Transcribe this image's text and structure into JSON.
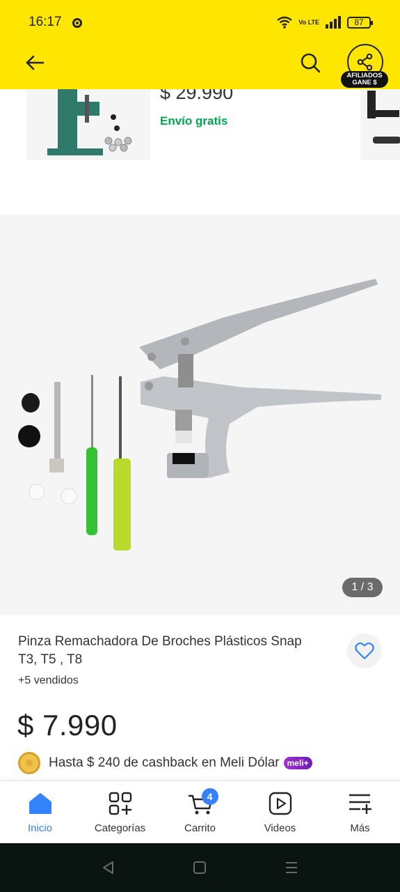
{
  "status_bar": {
    "time": "16:17",
    "network": "Vo LTE",
    "battery": "87"
  },
  "header": {
    "affiliates_badge": "AFILIADOS GANE $"
  },
  "recommendation": {
    "price": "$ 29.990",
    "shipping": "Envío gratis"
  },
  "gallery": {
    "counter": "1 / 3"
  },
  "product": {
    "title": "Pinza Remachadora De Broches Plásticos Snap T3, T5 , T8",
    "sold": "+5 vendidos",
    "price": "$ 7.990",
    "cashback": "Hasta $ 240 de cashback en Meli Dólar",
    "meli_badge": "meli+"
  },
  "bottom_nav": {
    "items": [
      {
        "label": "Inicio",
        "icon": "home-icon",
        "active": true
      },
      {
        "label": "Categorías",
        "icon": "categories-icon"
      },
      {
        "label": "Carrito",
        "icon": "cart-icon",
        "badge": "4"
      },
      {
        "label": "Videos",
        "icon": "play-icon"
      },
      {
        "label": "Más",
        "icon": "menu-plus-icon"
      }
    ]
  },
  "colors": {
    "header": "#ffe600",
    "accent": "#3483fa",
    "shipping": "#00a650"
  }
}
